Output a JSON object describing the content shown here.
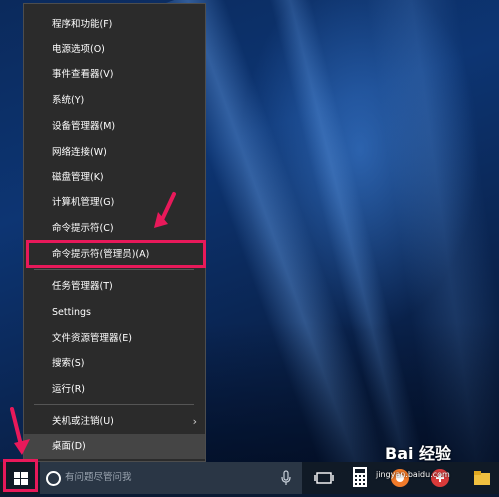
{
  "context_menu": {
    "items": [
      {
        "label": "程序和功能(F)"
      },
      {
        "label": "电源选项(O)"
      },
      {
        "label": "事件查看器(V)"
      },
      {
        "label": "系统(Y)"
      },
      {
        "label": "设备管理器(M)"
      },
      {
        "label": "网络连接(W)"
      },
      {
        "label": "磁盘管理(K)"
      },
      {
        "label": "计算机管理(G)"
      },
      {
        "label": "命令提示符(C)"
      },
      {
        "label": "命令提示符(管理员)(A)"
      },
      {
        "label": "任务管理器(T)"
      },
      {
        "label": "Settings"
      },
      {
        "label": "文件资源管理器(E)"
      },
      {
        "label": "搜索(S)"
      },
      {
        "label": "运行(R)"
      },
      {
        "label": "关机或注销(U)",
        "submenu_arrow": "›"
      },
      {
        "label": "桌面(D)"
      }
    ],
    "highlighted_item": "命令提示符(管理员)(A)"
  },
  "taskbar": {
    "search_placeholder": "有问题尽管问我",
    "icons": [
      "windows-logo-icon",
      "cortana-search-icon",
      "microphone-icon",
      "task-view-icon",
      "calculator-icon",
      "app-icon-orange",
      "app-icon-red",
      "file-explorer-icon"
    ]
  },
  "watermark": {
    "brand": "Bai 经验",
    "url": "jingyan.baidu.com"
  },
  "colors": {
    "menu_bg": "#2b2b2b",
    "menu_hover": "#454545",
    "annotation": "#e8195a",
    "taskbar_bg": "#101a26",
    "search_bg": "#2a3645"
  }
}
